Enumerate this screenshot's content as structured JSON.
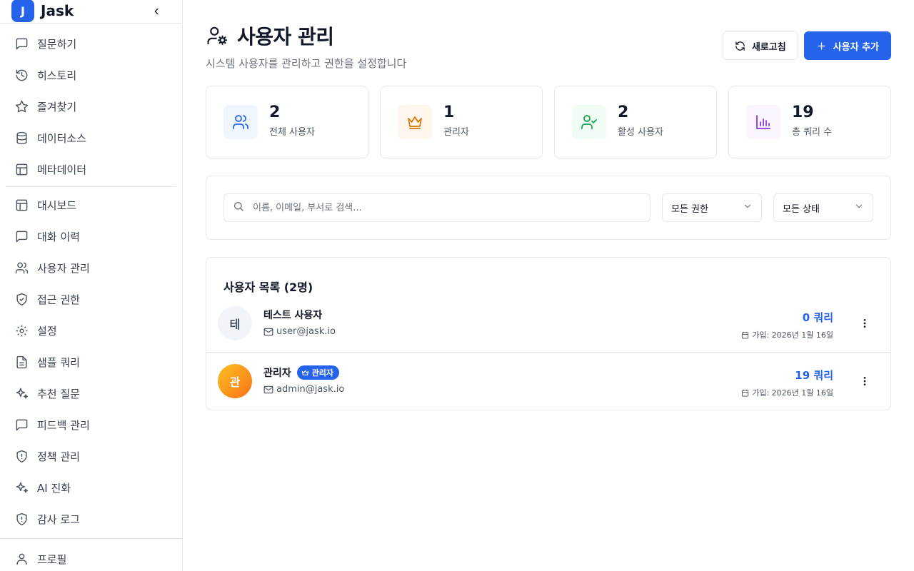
{
  "app": {
    "logo_letter": "J",
    "name": "Jask"
  },
  "sidebar": {
    "group1": [
      {
        "label": "질문하기",
        "icon": "message-square-icon"
      },
      {
        "label": "히스토리",
        "icon": "history-icon"
      },
      {
        "label": "즐겨찾기",
        "icon": "star-icon"
      },
      {
        "label": "데이터소스",
        "icon": "database-icon"
      },
      {
        "label": "메타데이터",
        "icon": "table-icon"
      }
    ],
    "group2": [
      {
        "label": "대시보드",
        "icon": "layout-icon"
      },
      {
        "label": "대화 이력",
        "icon": "message-square-icon"
      },
      {
        "label": "사용자 관리",
        "icon": "users-icon"
      },
      {
        "label": "접근 권한",
        "icon": "shield-check-icon"
      },
      {
        "label": "설정",
        "icon": "gear-icon"
      },
      {
        "label": "샘플 쿼리",
        "icon": "file-text-icon"
      },
      {
        "label": "추천 질문",
        "icon": "sparkles-icon"
      },
      {
        "label": "피드백 관리",
        "icon": "message-square-icon"
      },
      {
        "label": "정책 관리",
        "icon": "shield-alert-icon"
      },
      {
        "label": "AI 진화",
        "icon": "sparkles-icon"
      },
      {
        "label": "감사 로그",
        "icon": "shield-alert-icon"
      }
    ],
    "bottom": {
      "label": "프로필",
      "icon": "user-icon"
    }
  },
  "header": {
    "title": "사용자 관리",
    "subtitle": "시스템 사용자를 관리하고 권한을 설정합니다",
    "refresh_label": "새로고침",
    "add_label": "사용자 추가"
  },
  "stats": [
    {
      "value": "2",
      "label": "전체 사용자",
      "icon": "users-icon",
      "bg": "#eff6ff",
      "fg": "#2563eb"
    },
    {
      "value": "1",
      "label": "관리자",
      "icon": "crown-icon",
      "bg": "#fff7ed",
      "fg": "#d97706"
    },
    {
      "value": "2",
      "label": "활성 사용자",
      "icon": "user-check-icon",
      "bg": "#f0fdf4",
      "fg": "#16a34a"
    },
    {
      "value": "19",
      "label": "총 쿼리 수",
      "icon": "bar-chart-icon",
      "bg": "#faf5ff",
      "fg": "#9333ea"
    }
  ],
  "filters": {
    "search_placeholder": "이름, 이메일, 부서로 검색...",
    "role_selected": "모든 권한",
    "status_selected": "모든 상태"
  },
  "user_list": {
    "title": "사용자 목록 (2명)",
    "users": [
      {
        "avatar_letter": "테",
        "name": "테스트 사용자",
        "email": "user@jask.io",
        "queries": "0 쿼리",
        "joined": "가입: 2026년 1월 16일",
        "badge": ""
      },
      {
        "avatar_letter": "관",
        "name": "관리자",
        "email": "admin@jask.io",
        "queries": "19 쿼리",
        "joined": "가입: 2026년 1월 16일",
        "badge": "관리자"
      }
    ]
  },
  "colors": {
    "accent": "#2563eb",
    "border": "#e5e7eb",
    "muted_text": "#6b7280"
  }
}
